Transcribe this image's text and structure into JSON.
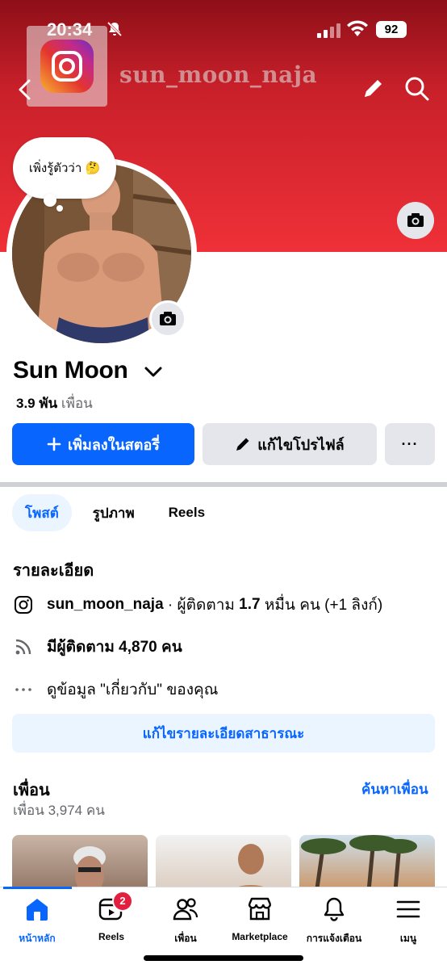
{
  "status_bar": {
    "time": "20:34",
    "battery": "92"
  },
  "watermark": {
    "instagram_handle": "sun_moon_naja"
  },
  "profile": {
    "thought_bubble": "เพิ่งรู้ตัวว่า 🤔",
    "name": "Sun Moon",
    "friends_count_number": "3.9 พัน",
    "friends_count_label": "เพื่อน"
  },
  "actions": {
    "add_story": "เพิ่มลงในสตอรี่",
    "edit_profile": "แก้ไขโปรไฟล์",
    "more": "···"
  },
  "tabs": [
    "โพสต์",
    "รูปภาพ",
    "Reels"
  ],
  "details": {
    "title": "รายละเอียด",
    "instagram_username": "sun_moon_naja",
    "instagram_suffix": " · ผู้ติดตาม ",
    "instagram_followers": "1.7",
    "instagram_suffix2": " หมื่น คน (+1 ลิงก์)",
    "followers_label": "มีผู้ติดตาม ",
    "followers_value": "4,870 คน",
    "about_link": "ดูข้อมูล \"เกี่ยวกับ\" ของคุณ",
    "edit_public_details": "แก้ไขรายละเอียดสาธารณะ"
  },
  "friends": {
    "title": "เพื่อน",
    "find_link": "ค้นหาเพื่อน",
    "count": "เพื่อน 3,974 คน"
  },
  "bottom_nav": {
    "home": "หน้าหลัก",
    "reels": "Reels",
    "reels_badge": "2",
    "friends": "เพื่อน",
    "marketplace": "Marketplace",
    "notifications": "การแจ้งเตือน",
    "menu": "เมนู"
  },
  "colors": {
    "accent": "#0866ff",
    "cover_top": "#8e0f18",
    "cover_bottom": "#ef3038",
    "badge": "#e41e3f"
  },
  "icons": [
    "back-icon",
    "pencil-icon",
    "search-icon",
    "camera-icon",
    "chevron-down-icon",
    "plus-icon",
    "instagram-icon",
    "rss-icon",
    "ellipsis-icon",
    "home-icon",
    "reels-icon",
    "friends-icon",
    "marketplace-icon",
    "bell-icon",
    "menu-icon"
  ]
}
